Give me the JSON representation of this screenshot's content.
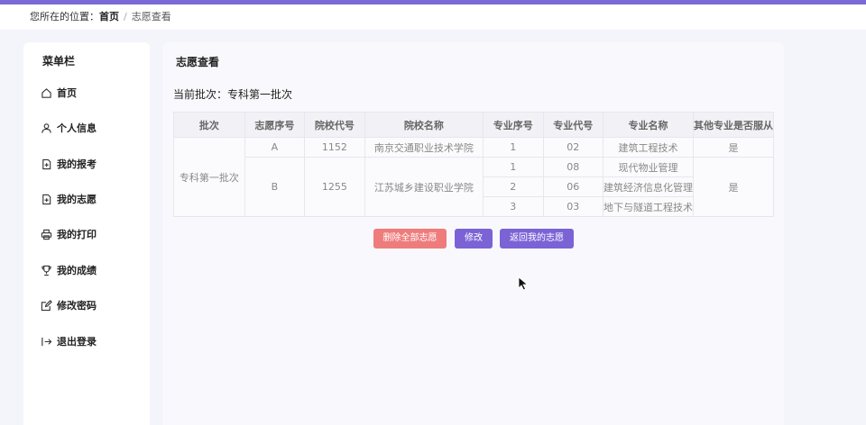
{
  "breadcrumb": {
    "prefix": "您所在的位置：",
    "home": "首页",
    "separator": "/",
    "current": "志愿查看"
  },
  "sidebar": {
    "title": "菜单栏",
    "items": [
      {
        "label": "首页",
        "icon": "home-icon"
      },
      {
        "label": "个人信息",
        "icon": "user-icon"
      },
      {
        "label": "我的报考",
        "icon": "file-add-icon"
      },
      {
        "label": "我的志愿",
        "icon": "file-add-icon"
      },
      {
        "label": "我的打印",
        "icon": "printer-icon"
      },
      {
        "label": "我的成绩",
        "icon": "trophy-icon"
      },
      {
        "label": "修改密码",
        "icon": "edit-icon"
      },
      {
        "label": "退出登录",
        "icon": "logout-icon"
      }
    ]
  },
  "main": {
    "title": "志愿查看",
    "batch_label": "当前批次：",
    "batch_value": "专科第一批次",
    "table": {
      "headers": [
        "批次",
        "志愿序号",
        "院校代号",
        "院校名称",
        "专业序号",
        "专业代号",
        "专业名称",
        "其他专业是否服从"
      ],
      "batch": "专科第一批次",
      "schools": [
        {
          "seq": "A",
          "code": "1152",
          "name": "南京交通职业技术学院",
          "obey": "是",
          "majors": [
            {
              "seq": "1",
              "code": "02",
              "name": "建筑工程技术"
            }
          ]
        },
        {
          "seq": "B",
          "code": "1255",
          "name": "江苏城乡建设职业学院",
          "obey": "是",
          "majors": [
            {
              "seq": "1",
              "code": "08",
              "name": "现代物业管理"
            },
            {
              "seq": "2",
              "code": "06",
              "name": "建筑经济信息化管理"
            },
            {
              "seq": "3",
              "code": "03",
              "name": "地下与隧道工程技术"
            }
          ]
        }
      ]
    },
    "buttons": {
      "delete_all": "删除全部志愿",
      "edit": "修改",
      "back": "返回我的志愿"
    }
  },
  "colors": {
    "accent": "#7b63d6",
    "danger": "#ef7c7c",
    "topbar": "#7a69d6"
  }
}
